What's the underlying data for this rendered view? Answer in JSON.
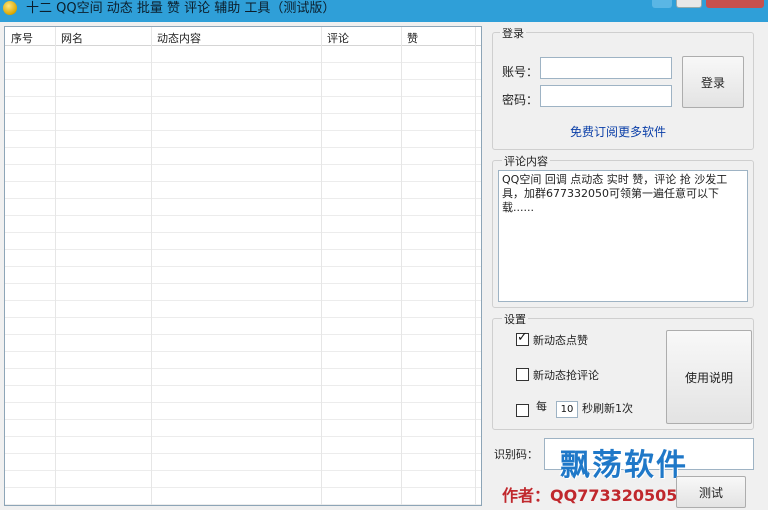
{
  "window": {
    "title": "十二 QQ空间 动态 批量 赞 评论 辅助 工具（测试版）",
    "colors": {
      "titlebar": "#2f9fd8",
      "close": "#c7504d"
    }
  },
  "list": {
    "columns": [
      "序号",
      "网名",
      "动态内容",
      "评论",
      "赞"
    ],
    "rows": []
  },
  "login": {
    "group_title": "登录",
    "account_label": "账号：",
    "password_label": "密码：",
    "account_value": "",
    "password_value": "",
    "login_button": "登录",
    "subscribe_link": "免费订阅更多软件"
  },
  "comment": {
    "group_title": "评论内容",
    "text": "QQ空间 回调 点动态 实时 赞，评论 抢 沙发工具，加群677332050可领第一遍任意可以下载......"
  },
  "settings": {
    "group_title": "设置",
    "auto_like_label": "新动态点赞",
    "auto_like_checked": true,
    "auto_comment_label": "新动态抢评论",
    "auto_comment_checked": false,
    "interval_prefix": "每",
    "interval_value": "10",
    "interval_suffix": "秒刷新1次",
    "interval_checked": false,
    "help_button": "使用说明"
  },
  "captcha": {
    "label": "识别码：",
    "value": ""
  },
  "footer": {
    "watermark": "飘荡软件",
    "author": "作者：QQ773320505",
    "test_button": "测试"
  }
}
